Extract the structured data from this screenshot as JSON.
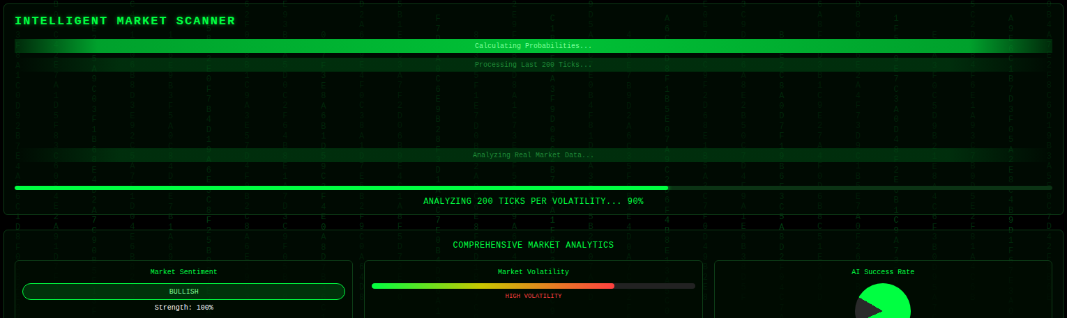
{
  "header": {
    "title": "INTELLIGENT MARKET SCANNER"
  },
  "scanner": {
    "lines": [
      {
        "text": "Calculating Probabilities...",
        "active": true
      },
      {
        "text": "Processing Last 200 Ticks...",
        "active": false
      },
      {
        "text": "Analyzing Real Market Data...",
        "active": false
      }
    ],
    "progress": {
      "level": 0.63,
      "label": "ANALYZING 200 TICKS PER VOLATILITY... 90%"
    }
  },
  "analytics": {
    "title": "COMPREHENSIVE MARKET ANALYTICS",
    "sentiment": {
      "title": "Market Sentiment",
      "value": "BULLISH",
      "strength": "Strength: 100%"
    },
    "volatility": {
      "title": "Market Volatility",
      "level": 0.75,
      "label": "HIGH VOLATILITY"
    },
    "success": {
      "title": "AI Success Rate",
      "level": 0.85
    }
  },
  "rain": [
    "3F8A1C0D92B7E4A56C1D8F03B2E97A",
    "B09C42E7A1D5F83C60B4E2A91D7F5C",
    "7E2D5A9C03F1B68E4D2A7C90B5E13F",
    "C4A1F06B8D3E92C5A7F1D04E6B82A9",
    "1D6E9B3F5A0C84D2E7B1A69F3C5D08",
    "A58C2E0F7B4D19A6E3C8F25B0D7E4A",
    "62F0D8B1C9A3E57D4F0B2C8A6E19D3",
    "E93B7A5D0C2F64B8E1A7D3C9F05B28",
    "0C7F3E8A6B1D59C2F4E0A8D7B36C1E",
    "D2A6B9E4F0C38A1D7E5B2F9C0A64D8",
    "5B1E8C3A7F2D06B9E4C1A8F5D73E20",
    "F7D4A0C6E9B28F3D1A5C7E0B4D96A1",
    "8A3C5F1E7D0B42A9C6E8F3D1B57C0E",
    "2E9F6B4D8A1C73E0F5B2D9A6C48E1B",
    "C1B8E5A3F9D06C2B7E4A1F8D35B0C9",
    "9D5A2C7E0B4F81D6A3E9C5B2F07A4D",
    "4F0E7B9D2A6C35F8B1E4D0A7C92F6B",
    "A6C3D8F1B5E07A9C2D6F4B8E13A5C0",
    "E0B7A4C9F2D68E1B5A3C7F0D49B2E8",
    "3C9D1F6A8E2B50C7D4F9A1E6B38D5F",
    "B4E2C8A0D7F19B6E3C5A8D2F04C7A1",
    "6A8F5D3B1C9E27A4F0D6B8C51E3A9D",
    "D8C0B6E2A4F73D9C1B5E7A0F26D8B4",
    "1F5B9E7C3A0D48F2E6B1C9A73F0D5E",
    "E7A3F0C5D9B21E8A4C6F3B0D95A7C2",
    "5C2D8B4F6E1A93C7B0D5E2F81A4C6B",
    "A9E6C1B7D3F05A2E8C4B9D1F67E3A0",
    "0B4A7E2F8C6D19B3A5E0C7D42F8B6E"
  ]
}
